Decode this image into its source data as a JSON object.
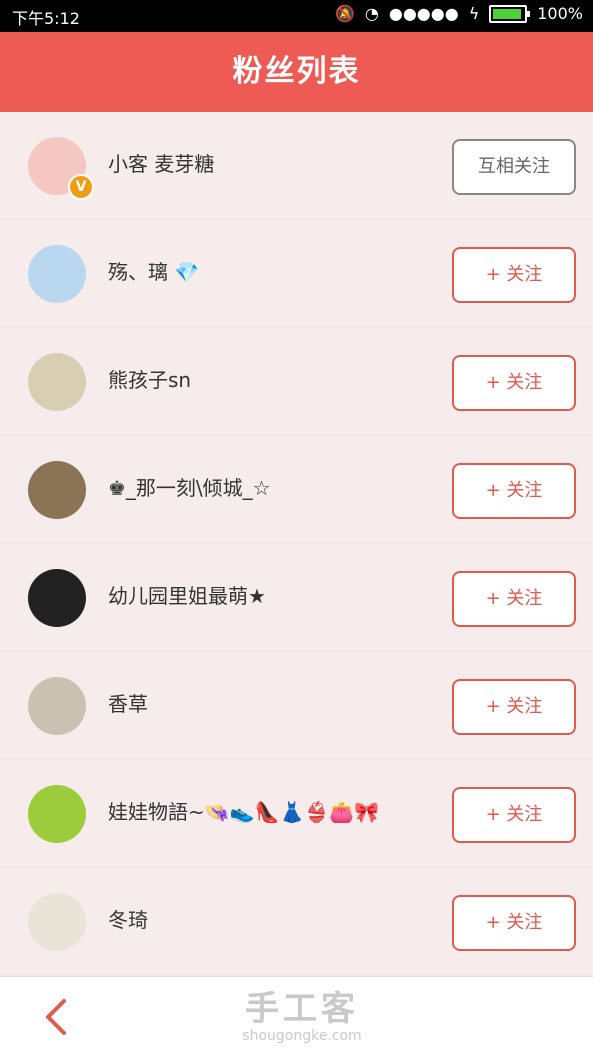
{
  "status_bar": {
    "time": "下午5:12",
    "signal": "●●●●●",
    "battery": "100%"
  },
  "header": {
    "title": "粉丝列表"
  },
  "fans": [
    {
      "name": "小客 麦芽糖",
      "action": "互相关注",
      "avatar_color": "#f4c7c3",
      "verified": true
    },
    {
      "name": "殇、璃 💎",
      "action": "+ 关注",
      "avatar_color": "#b9d8f0",
      "verified": false
    },
    {
      "name": "熊孩子sn",
      "action": "+ 关注",
      "avatar_color": "#d8cfb2",
      "verified": false
    },
    {
      "name": "♚_那一刻\\倾城_☆",
      "action": "+ 关注",
      "avatar_color": "#8b7355",
      "verified": false
    },
    {
      "name": "幼儿园里姐最萌★",
      "action": "+ 关注",
      "avatar_color": "#222222",
      "verified": false
    },
    {
      "name": "香草",
      "action": "+ 关注",
      "avatar_color": "#c9c2b2",
      "verified": false
    },
    {
      "name": "娃娃物語~👒👟👠👗👙👛🎀",
      "action": "+ 关注",
      "avatar_color": "#9ccc3b",
      "verified": false
    },
    {
      "name": "冬琦",
      "action": "+ 关注",
      "avatar_color": "#e8e4d8",
      "verified": false
    }
  ],
  "verified_badge": "V",
  "footer": {
    "watermark_title": "手工客",
    "watermark_url": "shougongke.com"
  },
  "colors": {
    "header_bg": "#ee5a54",
    "accent": "#e05a4e",
    "page_bg": "#f6ecec"
  }
}
